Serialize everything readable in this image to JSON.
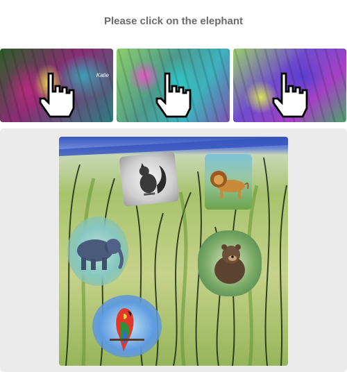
{
  "prompt": {
    "text": "Please click on the elephant"
  },
  "examples": [
    {
      "label": "example-1",
      "caption": "Katie"
    },
    {
      "label": "example-2"
    },
    {
      "label": "example-3"
    }
  ],
  "challenge": {
    "tiles": [
      {
        "animal": "squirrel",
        "icon": "squirrel-image"
      },
      {
        "animal": "lion",
        "icon": "lion-image"
      },
      {
        "animal": "elephant",
        "icon": "elephant-image"
      },
      {
        "animal": "bear",
        "icon": "bear-image"
      },
      {
        "animal": "parrot",
        "icon": "parrot-image"
      }
    ]
  },
  "colors": {
    "title": "#6b6b6b",
    "panel": "#ebebeb",
    "sky": "#3a57c2",
    "grass": "#a7c36d"
  }
}
